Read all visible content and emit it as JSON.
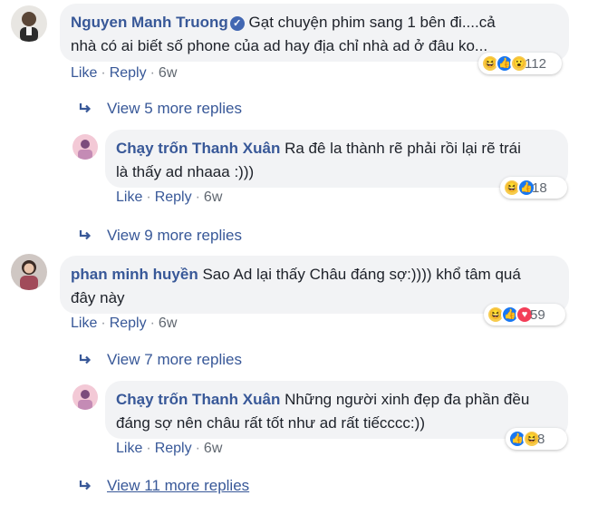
{
  "comments": [
    {
      "author": "Nguyen Manh Truong",
      "line1": "Gạt chuyện phim sang 1 bên đi....cả",
      "line2": "nhà có ai biết số phone của ad hay địa chỉ nhà ad ở đâu ko...",
      "like": "Like",
      "reply": "Reply",
      "time": "6w",
      "reaction_count": "112",
      "reactions": [
        "haha",
        "like",
        "wow"
      ],
      "verified": true
    },
    {
      "author": "Chạy trốn Thanh Xuân",
      "line1": "Ra đê la thành rẽ phải rồi lại rẽ trái",
      "line2": "là thấy ad nhaaa :)))",
      "like": "Like",
      "reply": "Reply",
      "time": "6w",
      "reaction_count": "18",
      "reactions": [
        "haha",
        "like"
      ]
    },
    {
      "author": "phan minh huyền",
      "line1": "Sao Ad lại thấy Châu đáng sợ:)))) khổ tâm quá",
      "line2": "đây này",
      "like": "Like",
      "reply": "Reply",
      "time": "6w",
      "reaction_count": "59",
      "reactions": [
        "haha",
        "like",
        "love"
      ]
    },
    {
      "author": "Chạy trốn Thanh Xuân",
      "line1": "Những người xinh đẹp đa phần đều",
      "line2": "đáng sợ nên châu rất tốt như ad rất tiếcccc:))",
      "like": "Like",
      "reply": "Reply",
      "time": "6w",
      "reaction_count": "8",
      "reactions": [
        "like",
        "haha"
      ]
    }
  ],
  "more_replies": [
    "View 5 more replies",
    "View 9 more replies",
    "View 7 more replies",
    "View 11 more replies"
  ],
  "colors": {
    "link": "#385898",
    "bubble": "#f2f3f5",
    "meta": "#606770"
  }
}
